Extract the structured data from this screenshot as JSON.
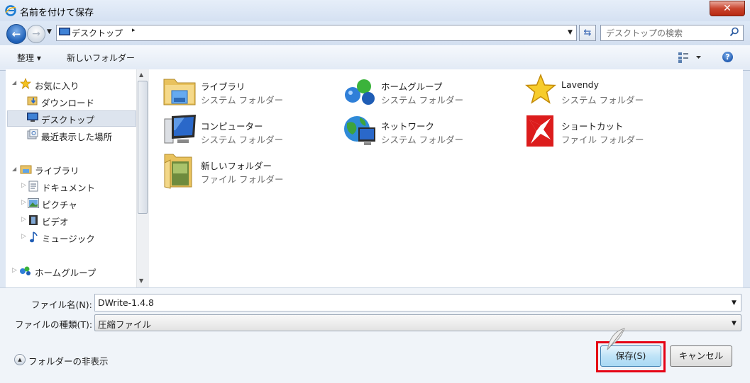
{
  "window": {
    "title": "名前を付けて保存",
    "close_label": "✕"
  },
  "address": {
    "location": "デスクトップ",
    "separator": "▸"
  },
  "search": {
    "placeholder": "デスクトップの検索"
  },
  "toolbar": {
    "organize_label": "整理 ▾",
    "new_folder_label": "新しいフォルダー",
    "help_label": "?"
  },
  "nav_pane": {
    "favorites_label": "お気に入り",
    "favorites": [
      {
        "label": "ダウンロード"
      },
      {
        "label": "デスクトップ",
        "selected": true
      },
      {
        "label": "最近表示した場所"
      }
    ],
    "libraries_label": "ライブラリ",
    "libraries": [
      {
        "label": "ドキュメント"
      },
      {
        "label": "ピクチャ"
      },
      {
        "label": "ビデオ"
      },
      {
        "label": "ミュージック"
      }
    ],
    "homegroup_label": "ホームグループ"
  },
  "items": [
    {
      "name": "ライブラリ",
      "type": "システム フォルダー",
      "icon": "library-icon"
    },
    {
      "name": "ホームグループ",
      "type": "システム フォルダー",
      "icon": "homegroup-icon"
    },
    {
      "name": "Lavendy",
      "type": "システム フォルダー",
      "icon": "star-icon"
    },
    {
      "name": "コンピューター",
      "type": "システム フォルダー",
      "icon": "computer-icon"
    },
    {
      "name": "ネットワーク",
      "type": "システム フォルダー",
      "icon": "network-icon"
    },
    {
      "name": "ショートカット",
      "type": "ファイル フォルダー",
      "icon": "shortcut-icon"
    },
    {
      "name": "新しいフォルダー",
      "type": "ファイル フォルダー",
      "icon": "folder-icon"
    }
  ],
  "bottom": {
    "filename_label": "ファイル名(N):",
    "filename_value": "DWrite-1.4.8",
    "filetype_label": "ファイルの種類(T):",
    "filetype_value": "圧縮ファイル",
    "hide_folders_label": "フォルダーの非表示",
    "save_label": "保存(S)",
    "cancel_label": "キャンセル"
  },
  "colors": {
    "highlight_border": "#e50014",
    "accent": "#1d5fb7"
  }
}
